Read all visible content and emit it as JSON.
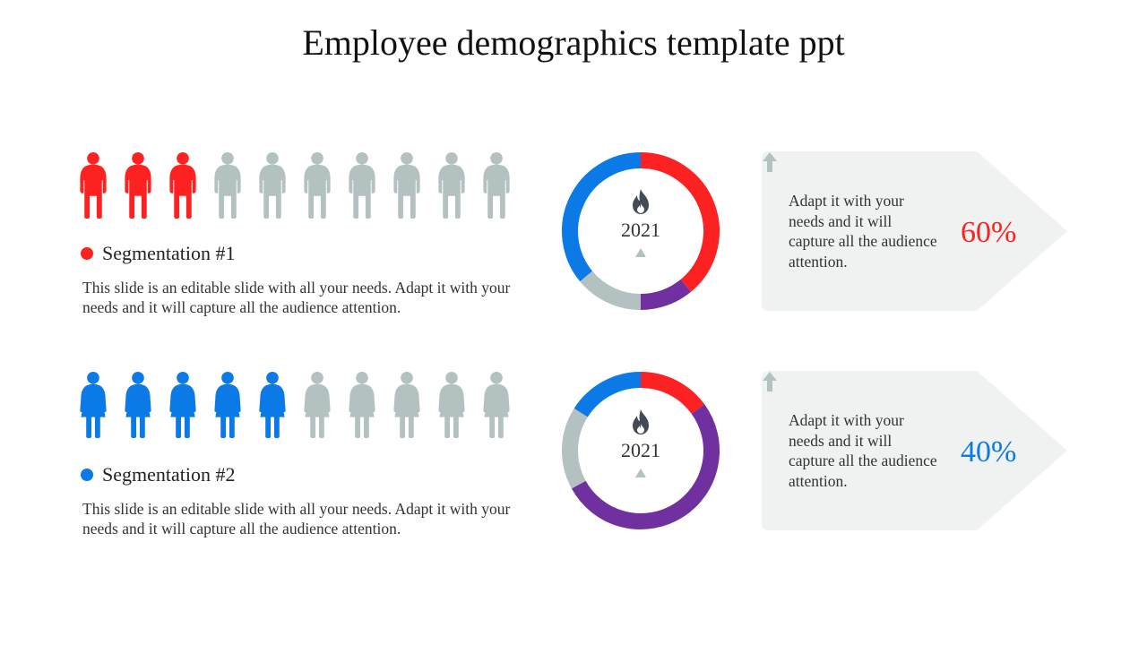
{
  "title": "Employee demographics template ppt",
  "colors": {
    "red": "#fd2222",
    "blue": "#0b7ae6",
    "purple": "#7030a0",
    "gray": "#b4c1c1",
    "icon_dark": "#434c56",
    "card_bg": "#f0f1f1"
  },
  "segments": [
    {
      "label": "Segmentation #1",
      "description": "This slide is an editable slide with all your needs. Adapt it with your needs and it will capture all the audience attention.",
      "icon_type": "male-person",
      "total_icons": 10,
      "highlighted_icons": 3,
      "highlight_color": "#fd2222",
      "ring": {
        "year": "2021",
        "icon": "fire-icon",
        "slices": [
          {
            "name": "red",
            "color": "#fd2222",
            "fraction": 0.39
          },
          {
            "name": "purple",
            "color": "#7030a0",
            "fraction": 0.11
          },
          {
            "name": "gray",
            "color": "#b4c1c1",
            "fraction": 0.14
          },
          {
            "name": "blue",
            "color": "#0b7ae6",
            "fraction": 0.36
          }
        ]
      },
      "card": {
        "text": "Adapt it with your needs and it will capture all the audience attention.",
        "percent": "60%",
        "percent_color": "#fd2222"
      }
    },
    {
      "label": "Segmentation #2",
      "description": "This slide is an editable slide with all your needs. Adapt it with your needs and it will capture all the audience attention.",
      "icon_type": "female-person",
      "total_icons": 10,
      "highlighted_icons": 5,
      "highlight_color": "#0b7ae6",
      "ring": {
        "year": "2021",
        "icon": "fire-icon",
        "slices": [
          {
            "name": "red",
            "color": "#fd2222",
            "fraction": 0.15
          },
          {
            "name": "purple",
            "color": "#7030a0",
            "fraction": 0.52
          },
          {
            "name": "gray",
            "color": "#b4c1c1",
            "fraction": 0.17
          },
          {
            "name": "blue",
            "color": "#0b7ae6",
            "fraction": 0.16
          }
        ]
      },
      "card": {
        "text": "Adapt it with your needs and it will capture all the audience attention.",
        "percent": "40%",
        "percent_color": "#0b7ae6"
      }
    }
  ]
}
